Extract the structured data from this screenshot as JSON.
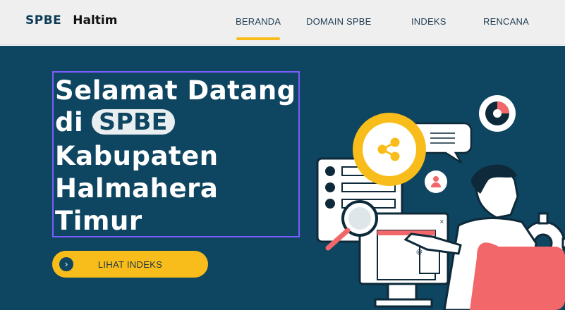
{
  "brand": {
    "part1": "SPBE",
    "part2": "Haltim"
  },
  "nav": {
    "items": [
      {
        "label": "BERANDA",
        "active": true
      },
      {
        "label": "DOMAIN SPBE",
        "active": false
      },
      {
        "label": "INDEKS",
        "active": false
      },
      {
        "label": "RENCANA",
        "active": false
      }
    ]
  },
  "hero": {
    "line1": "Selamat Datang",
    "line2_prefix": "di",
    "line2_pill": "SPBE",
    "line3": "Kabupaten",
    "line4": "Halmahera",
    "line5": "Timur",
    "cta_label": "LIHAT INDEKS",
    "cta_icon": "chevron-right-icon"
  },
  "colors": {
    "hero_bg": "#0e4560",
    "accent": "#f8bd1a",
    "selection_border": "#7b5cff",
    "illustration_coral": "#f2686a"
  },
  "illustration": {
    "icons": [
      "share-icon",
      "pie-chart-icon",
      "user-icon",
      "magnifier-icon",
      "gear-icon",
      "chat-bubble-icon",
      "close-icon",
      "at-icon"
    ]
  }
}
